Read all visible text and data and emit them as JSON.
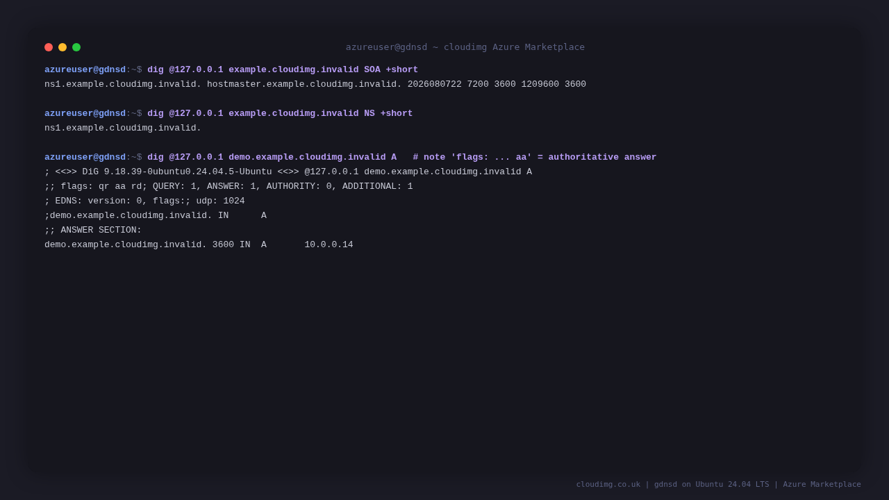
{
  "window": {
    "title": "azureuser@gdnsd ~ cloudimg Azure Marketplace",
    "controls": [
      {
        "kind": "close",
        "color": "#ff5f57"
      },
      {
        "kind": "minimize",
        "color": "#febc2e"
      },
      {
        "kind": "maximize",
        "color": "#28c840"
      }
    ]
  },
  "sessions": [
    {
      "user": "azureuser@gdnsd",
      "path": ":~$",
      "command": "dig @127.0.0.1 example.cloudimg.invalid SOA +short",
      "output": [
        "ns1.example.cloudimg.invalid. hostmaster.example.cloudimg.invalid. 2026080722 7200 3600 1209600 3600"
      ]
    },
    {
      "user": "azureuser@gdnsd",
      "path": ":~$",
      "command": "dig @127.0.0.1 example.cloudimg.invalid NS +short",
      "output": [
        "ns1.example.cloudimg.invalid."
      ]
    },
    {
      "user": "azureuser@gdnsd",
      "path": ":~$",
      "command": "dig @127.0.0.1 demo.example.cloudimg.invalid A   # note 'flags: ... aa' = authoritative answer",
      "output": [
        "; <<>> DiG 9.18.39-0ubuntu0.24.04.5-Ubuntu <<>> @127.0.0.1 demo.example.cloudimg.invalid A",
        ";; flags: qr aa rd; QUERY: 1, ANSWER: 1, AUTHORITY: 0, ADDITIONAL: 1",
        "; EDNS: version: 0, flags:; udp: 1024",
        ";demo.example.cloudimg.invalid. IN      A",
        ";; ANSWER SECTION:",
        "demo.example.cloudimg.invalid. 3600 IN  A       10.0.0.14"
      ]
    }
  ],
  "footer": "cloudimg.co.uk | gdnsd on Ubuntu 24.04 LTS | Azure Marketplace"
}
